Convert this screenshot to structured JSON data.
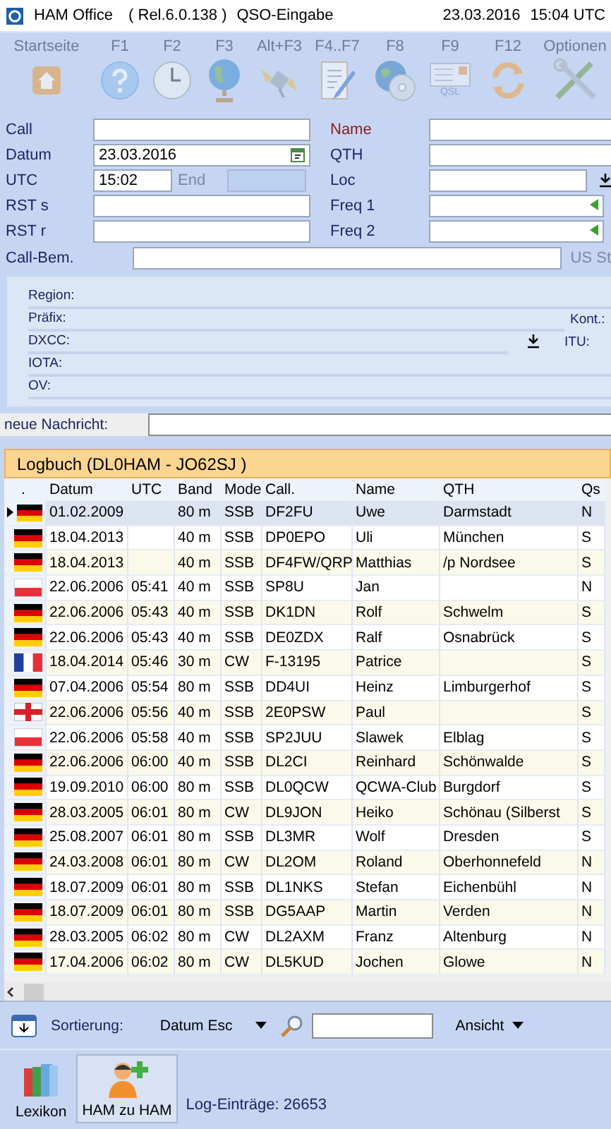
{
  "window": {
    "app": "HAM Office",
    "release": "( Rel.6.0.138 )",
    "title": "QSO-Eingabe",
    "date": "23.03.2016",
    "time": "15:04 UTC"
  },
  "toolbar": [
    {
      "label": "Startseite",
      "kind": "home",
      "disabled": true
    },
    {
      "label": "F1",
      "kind": "help",
      "disabled": true
    },
    {
      "label": "F2",
      "kind": "clock",
      "disabled": true
    },
    {
      "label": "F3",
      "kind": "globe",
      "disabled": true
    },
    {
      "label": "Alt+F3",
      "kind": "satellite",
      "disabled": true
    },
    {
      "label": "F4..F7",
      "kind": "notepad",
      "disabled": true
    },
    {
      "label": "F8",
      "kind": "disc",
      "disabled": true
    },
    {
      "label": "F9",
      "kind": "card",
      "icon_text": "QSL",
      "disabled": true
    },
    {
      "label": "F12",
      "kind": "refresh",
      "disabled": true
    },
    {
      "label": "Optionen",
      "kind": "tools",
      "disabled": true
    }
  ],
  "form": {
    "left": [
      {
        "label": "Call",
        "kind": "text",
        "emphasis": false
      },
      {
        "label": "Datum",
        "kind": "date",
        "value": "23.03.2016",
        "emphasis": false
      },
      {
        "label": "UTC",
        "kind": "time",
        "value": "15:02",
        "end_label": "End",
        "end_disabled": true,
        "emphasis": false
      },
      {
        "label": "RST s",
        "kind": "text",
        "emphasis": false
      },
      {
        "label": "RST r",
        "kind": "text",
        "emphasis": false
      }
    ],
    "right": [
      {
        "label": "Name",
        "kind": "text",
        "emphasis": true
      },
      {
        "label": "QTH",
        "kind": "text",
        "emphasis": false
      },
      {
        "label": "Loc",
        "kind": "lookup",
        "emphasis": false
      },
      {
        "label": "Freq 1",
        "kind": "freq",
        "emphasis": false
      },
      {
        "label": "Freq 2",
        "kind": "freq",
        "emphasis": false
      }
    ],
    "remark": {
      "label": "Call-Bem.",
      "side_label": "US St"
    }
  },
  "info": {
    "rows": [
      {
        "label": "Region:",
        "kind": "plain"
      },
      {
        "label": "Präfix:",
        "kind": "plain",
        "side_label": "Kont.:"
      },
      {
        "label": "DXCC:",
        "kind": "lookup",
        "side_label": "ITU:"
      },
      {
        "label": "IOTA:",
        "kind": "plain"
      },
      {
        "label": "OV:",
        "kind": "plain"
      }
    ]
  },
  "message": {
    "label": "neue Nachricht:"
  },
  "logbook": {
    "title": "Logbuch  (DL0HAM - JO62SJ )",
    "marker_header": ".",
    "columns": [
      "Datum",
      "UTC",
      "Band",
      "Mode",
      "Call.",
      "Name",
      "QTH",
      "Qs"
    ],
    "rows": [
      {
        "kind": "de",
        "selected": true,
        "cells": [
          "01.02.2009",
          null,
          "80 m",
          "SSB",
          "DF2FU",
          "Uwe",
          "Darmstadt",
          "N"
        ]
      },
      {
        "kind": "de",
        "selected": false,
        "cells": [
          "18.04.2013",
          null,
          "40 m",
          "SSB",
          "DP0EPO",
          "Uli",
          "München",
          "S"
        ]
      },
      {
        "kind": "de",
        "selected": false,
        "cells": [
          "18.04.2013",
          null,
          "40 m",
          "SSB",
          "DF4FW/QRP",
          "Matthias",
          "/p Nordsee",
          "S"
        ]
      },
      {
        "kind": "pl",
        "selected": false,
        "cells": [
          "22.06.2006",
          "05:41",
          "40 m",
          "SSB",
          "SP8U",
          "Jan",
          null,
          "N"
        ]
      },
      {
        "kind": "de",
        "selected": false,
        "cells": [
          "22.06.2006",
          "05:43",
          "40 m",
          "SSB",
          "DK1DN",
          "Rolf",
          "Schwelm",
          "S"
        ]
      },
      {
        "kind": "de",
        "selected": false,
        "cells": [
          "22.06.2006",
          "05:43",
          "40 m",
          "SSB",
          "DE0ZDX",
          "Ralf",
          "Osnabrück",
          "S"
        ]
      },
      {
        "kind": "fr",
        "selected": false,
        "cells": [
          "18.04.2014",
          "05:46",
          "30 m",
          "CW",
          "F-13195",
          "Patrice",
          null,
          "S"
        ]
      },
      {
        "kind": "de",
        "selected": false,
        "cells": [
          "07.04.2006",
          "05:54",
          "80 m",
          "SSB",
          "DD4UI",
          "Heinz",
          "Limburgerhof",
          "S"
        ]
      },
      {
        "kind": "en",
        "selected": false,
        "cells": [
          "22.06.2006",
          "05:56",
          "40 m",
          "SSB",
          "2E0PSW",
          "Paul",
          null,
          "S"
        ]
      },
      {
        "kind": "pl",
        "selected": false,
        "cells": [
          "22.06.2006",
          "05:58",
          "40 m",
          "SSB",
          "SP2JUU",
          "Slawek",
          "Elblag",
          "S"
        ]
      },
      {
        "kind": "de",
        "selected": false,
        "cells": [
          "22.06.2006",
          "06:00",
          "40 m",
          "SSB",
          "DL2CI",
          "Reinhard",
          "Schönwalde",
          "S"
        ]
      },
      {
        "kind": "de",
        "selected": false,
        "cells": [
          "19.09.2010",
          "06:00",
          "80 m",
          "SSB",
          "DL0QCW",
          "QCWA-Club",
          "Burgdorf",
          "S"
        ]
      },
      {
        "kind": "de",
        "selected": false,
        "cells": [
          "28.03.2005",
          "06:01",
          "80 m",
          "CW",
          "DL9JON",
          "Heiko",
          "Schönau (Silberst",
          "S"
        ]
      },
      {
        "kind": "de",
        "selected": false,
        "cells": [
          "25.08.2007",
          "06:01",
          "80 m",
          "SSB",
          "DL3MR",
          "Wolf",
          "Dresden",
          "S"
        ]
      },
      {
        "kind": "de",
        "selected": false,
        "cells": [
          "24.03.2008",
          "06:01",
          "80 m",
          "CW",
          "DL2OM",
          "Roland",
          "Oberhonnefeld",
          "N"
        ]
      },
      {
        "kind": "de",
        "selected": false,
        "cells": [
          "18.07.2009",
          "06:01",
          "80 m",
          "SSB",
          "DL1NKS",
          "Stefan",
          "Eichenbühl",
          "N"
        ]
      },
      {
        "kind": "de",
        "selected": false,
        "cells": [
          "18.07.2009",
          "06:01",
          "80 m",
          "SSB",
          "DG5AAP",
          "Martin",
          "Verden",
          "N"
        ]
      },
      {
        "kind": "de",
        "selected": false,
        "cells": [
          "28.03.2005",
          "06:02",
          "80 m",
          "CW",
          "DL2AXM",
          "Franz",
          "Altenburg",
          "N"
        ]
      },
      {
        "kind": "de",
        "selected": false,
        "cells": [
          "17.04.2006",
          "06:02",
          "80 m",
          "CW",
          "DL5KUD",
          "Jochen",
          "Glowe",
          "N"
        ]
      }
    ]
  },
  "sortbar": {
    "label": "Sortierung:",
    "value": "Datum Esc",
    "view_label": "Ansicht"
  },
  "footer": {
    "buttons": [
      {
        "label": "Lexikon",
        "kind": "books"
      },
      {
        "label": "HAM zu HAM",
        "kind": "contact"
      }
    ],
    "count": "Log-Einträge: 26653"
  }
}
